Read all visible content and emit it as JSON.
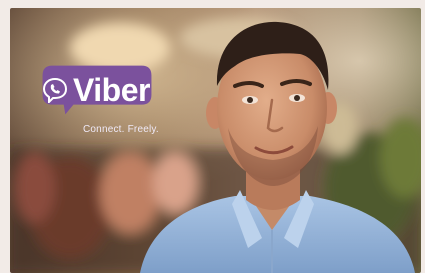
{
  "logo": {
    "wordmark": "Viber",
    "tagline": "Connect. Freely.",
    "icon": "phone-in-speech-bubble-icon",
    "brand_color": "#7b519d"
  },
  "photo": {
    "subject": "man-in-blue-shirt"
  }
}
